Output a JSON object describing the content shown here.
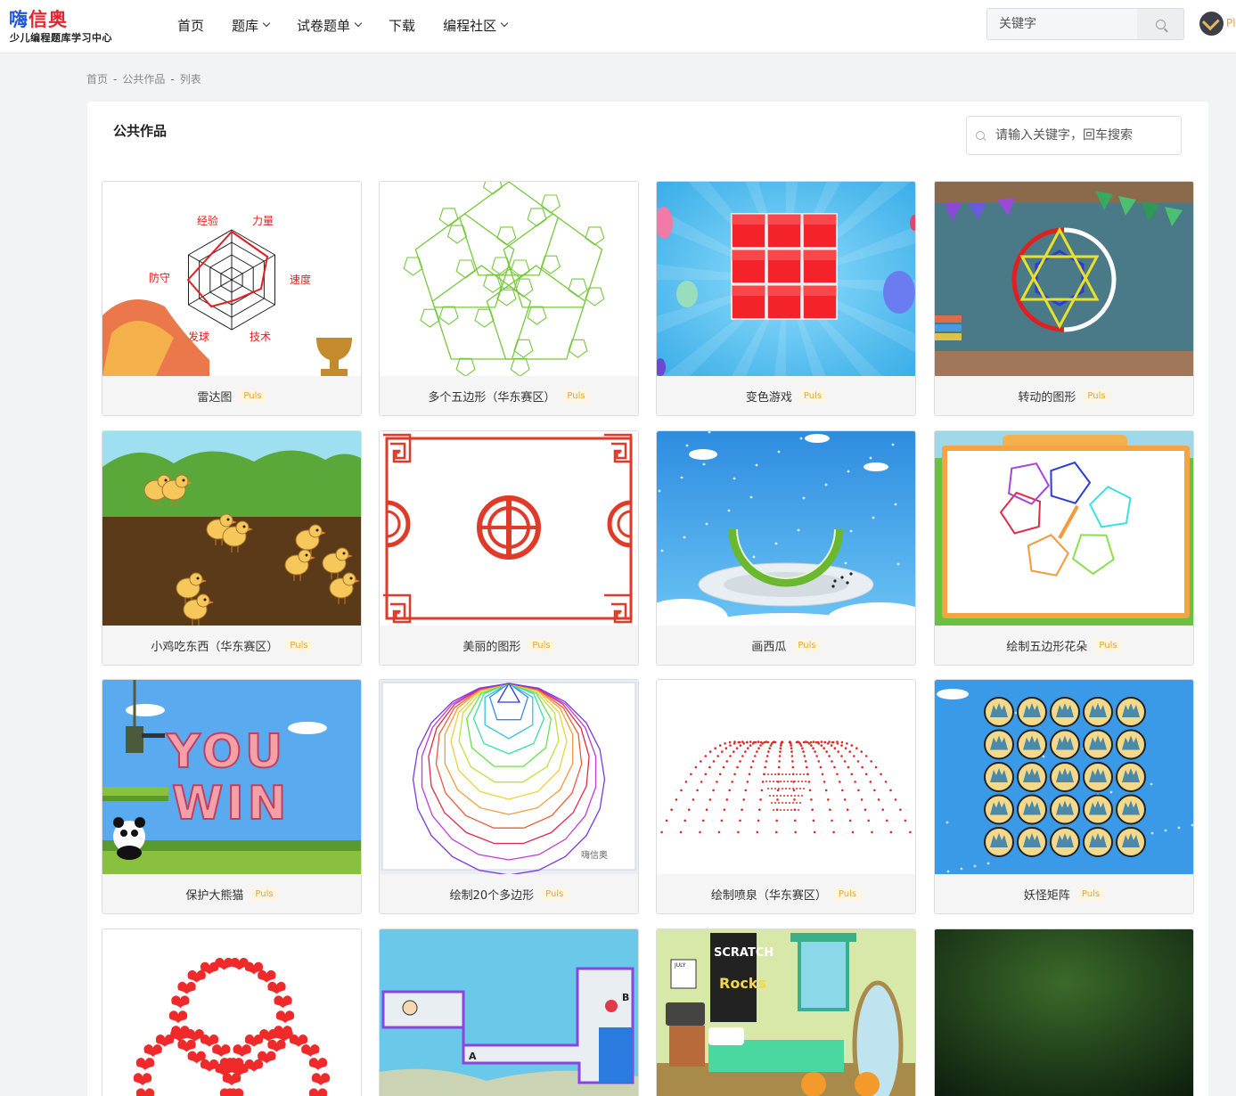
{
  "logo": {
    "title_part1": "嗨",
    "title_part2": "信奥",
    "subtitle": "少儿编程题库学习中心"
  },
  "nav": {
    "items": [
      {
        "label": "首页",
        "has_dropdown": false
      },
      {
        "label": "题库",
        "has_dropdown": true
      },
      {
        "label": "试卷题单",
        "has_dropdown": true
      },
      {
        "label": "下载",
        "has_dropdown": false
      },
      {
        "label": "编程社区",
        "has_dropdown": true
      }
    ]
  },
  "top_search": {
    "placeholder": "关键字"
  },
  "user": {
    "vip_text": "Pl"
  },
  "breadcrumb": [
    "首页",
    "公共作品",
    "列表"
  ],
  "breadcrumb_sep": "-",
  "panel": {
    "title": "公共作品",
    "search_placeholder": "请输入关键字，回车搜索"
  },
  "badge_label": "Puls",
  "projects": [
    {
      "name": "雷达图",
      "thumb": "radar",
      "labels": [
        "经验",
        "力量",
        "速度",
        "技术",
        "发球",
        "防守"
      ]
    },
    {
      "name": "多个五边形（华东赛区）",
      "thumb": "pentagons"
    },
    {
      "name": "变色游戏",
      "thumb": "colorgame"
    },
    {
      "name": "转动的图形",
      "thumb": "rotating"
    },
    {
      "name": "小鸡吃东西（华东赛区）",
      "thumb": "chicks"
    },
    {
      "name": "美丽的图形",
      "thumb": "pattern"
    },
    {
      "name": "画西瓜",
      "thumb": "watermelon"
    },
    {
      "name": "绘制五边形花朵",
      "thumb": "flower"
    },
    {
      "name": "保护大熊猫",
      "thumb": "panda",
      "text1": "YOU",
      "text2": "WIN"
    },
    {
      "name": "绘制20个多边形",
      "thumb": "polygons",
      "watermark": "嗨信奥"
    },
    {
      "name": "绘制喷泉（华东赛区）",
      "thumb": "fountain"
    },
    {
      "name": "妖怪矩阵",
      "thumb": "monsters"
    },
    {
      "name": "",
      "thumb": "hearts"
    },
    {
      "name": "",
      "thumb": "maze",
      "label_a": "A",
      "label_b": "B"
    },
    {
      "name": "",
      "thumb": "room",
      "poster1": "SCRATCH",
      "poster2": "Rocks",
      "calendar": "JULY"
    },
    {
      "name": "",
      "thumb": "dark"
    }
  ]
}
